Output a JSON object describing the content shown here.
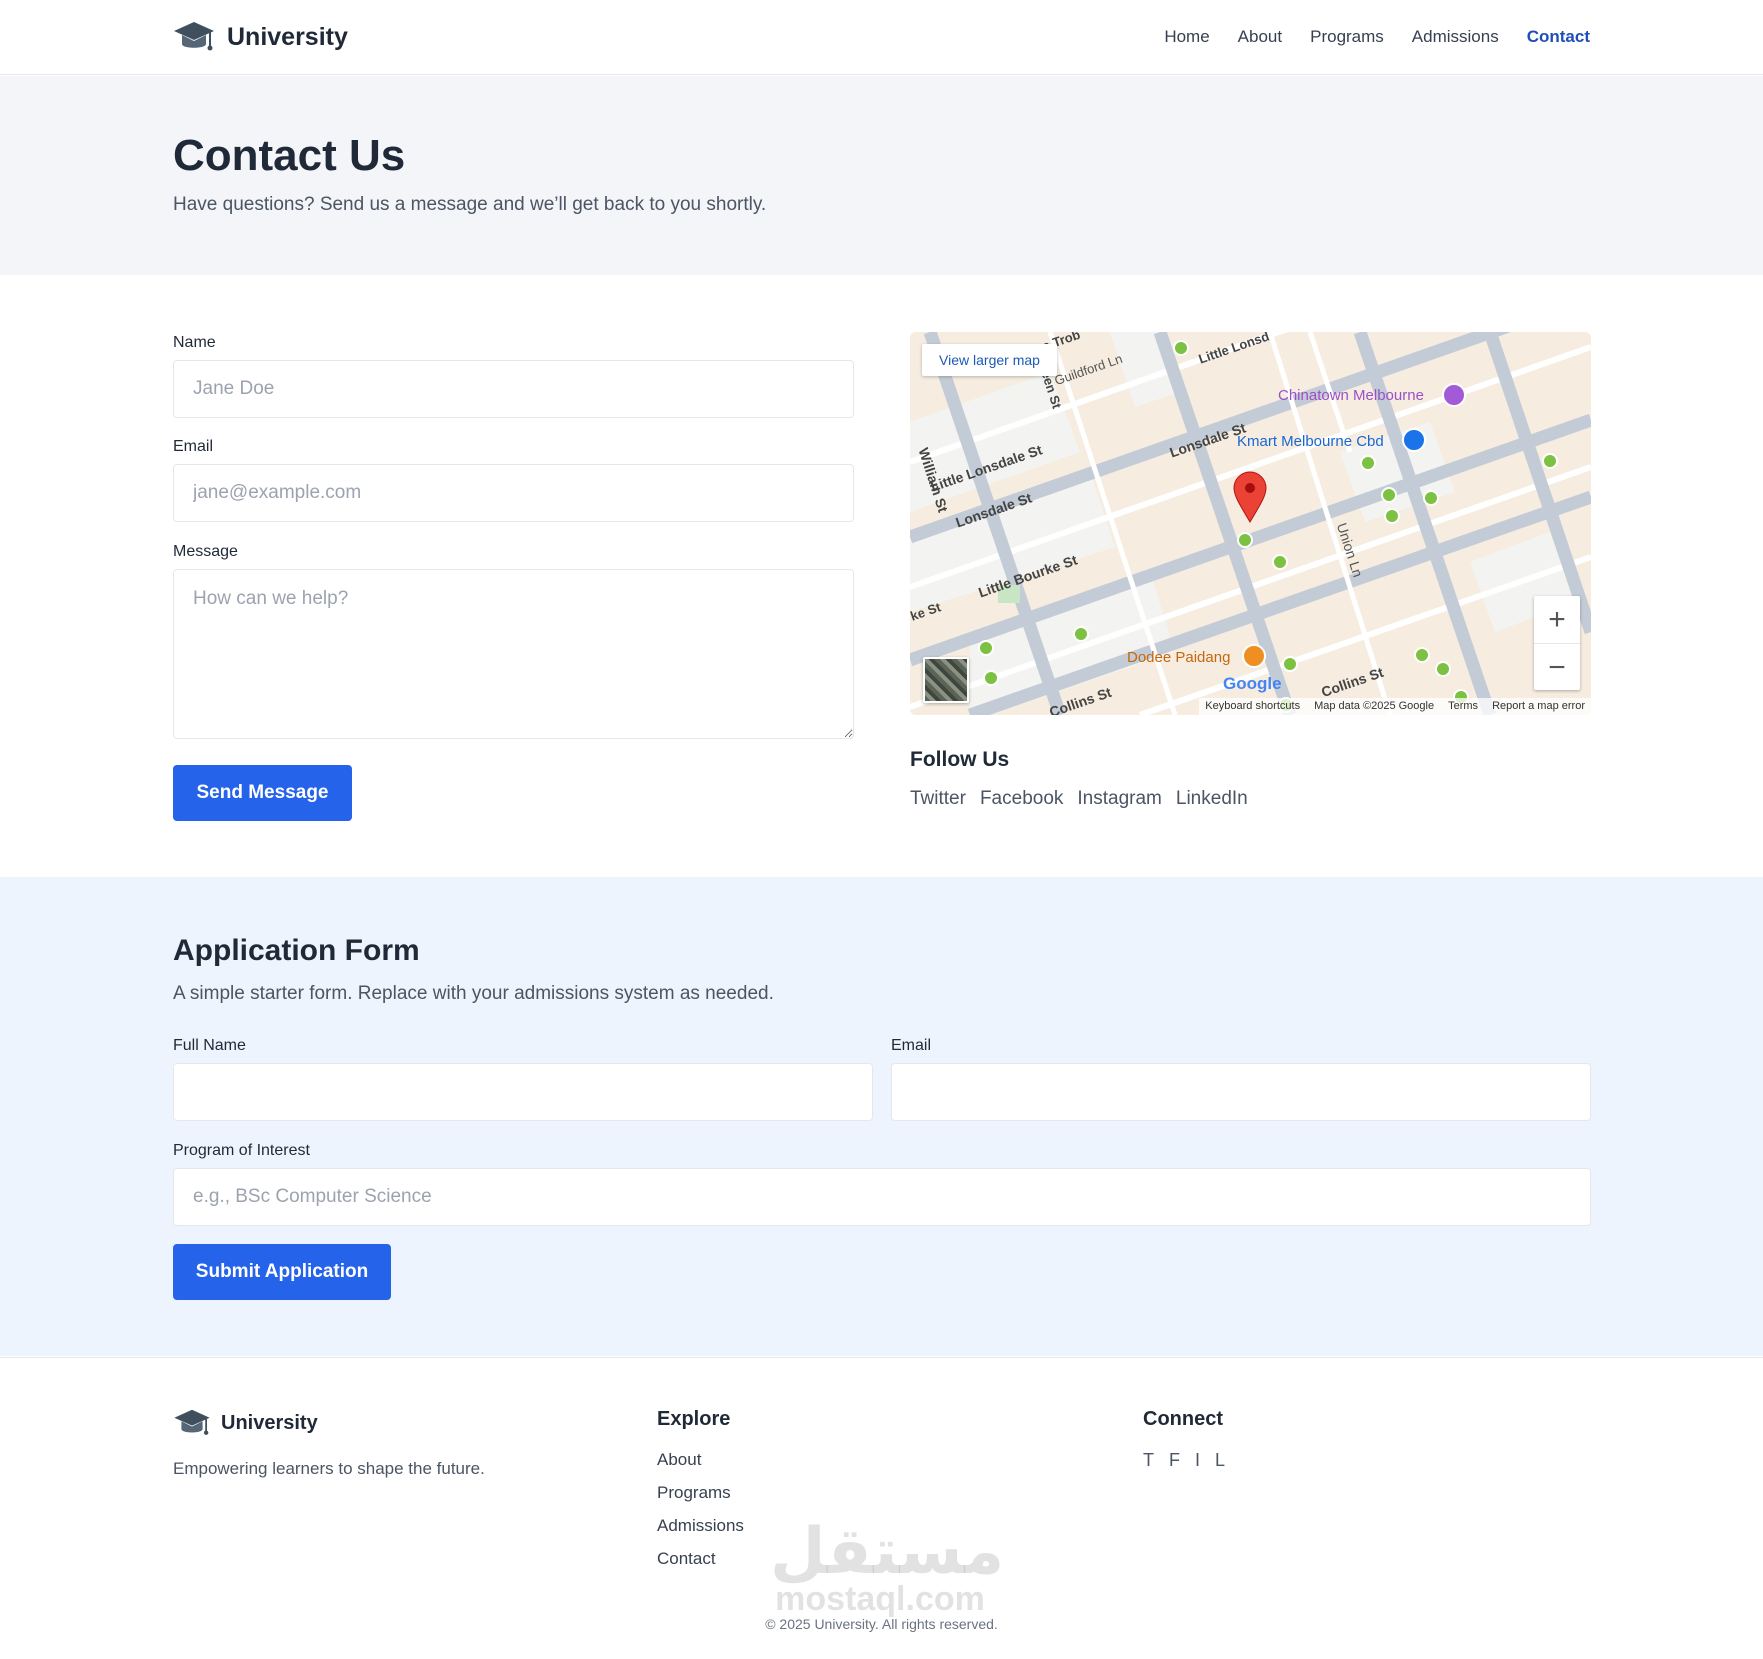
{
  "header": {
    "brand": "University",
    "nav": [
      "Home",
      "About",
      "Programs",
      "Admissions",
      "Contact"
    ],
    "active_nav": "Contact"
  },
  "hero": {
    "title": "Contact Us",
    "subtitle": "Have questions? Send us a message and we’ll get back to you shortly."
  },
  "contact_form": {
    "name_label": "Name",
    "name_placeholder": "Jane Doe",
    "email_label": "Email",
    "email_placeholder": "jane@example.com",
    "message_label": "Message",
    "message_placeholder": "How can we help?",
    "submit_label": "Send Message"
  },
  "map": {
    "view_larger": "View larger map",
    "streets": [
      "Little Lonsdale St",
      "Lonsdale St",
      "Little Bourke St",
      "Collins St",
      "William St",
      "Union Ln",
      "Guildford Ln",
      "Little Lonsd",
      "La Trob",
      "ke St",
      "een St",
      "Lonsdale St",
      "Collins St"
    ],
    "places": [
      "Chinatown Melbourne",
      "Kmart Melbourne Cbd",
      "Dodee Paidang"
    ],
    "zoom_in": "+",
    "zoom_out": "−",
    "google": "Google",
    "attribution": [
      "Keyboard shortcuts",
      "Map data ©2025 Google",
      "Terms",
      "Report a map error"
    ],
    "colors": {
      "road": "#ffffff",
      "major_road": "#c3ccd6",
      "land": "#f6ede0",
      "block": "#f3f3f1",
      "pin": "#ea4335",
      "transit": "#7cc142"
    }
  },
  "follow": {
    "title": "Follow Us",
    "links": [
      "Twitter",
      "Facebook",
      "Instagram",
      "LinkedIn"
    ]
  },
  "application": {
    "title": "Application Form",
    "subtitle": "A simple starter form. Replace with your admissions system as needed.",
    "full_name_label": "Full Name",
    "email_label": "Email",
    "program_label": "Program of Interest",
    "program_placeholder": "e.g., BSc Computer Science",
    "submit_label": "Submit Application"
  },
  "footer": {
    "brand": "University",
    "tagline": "Empowering learners to shape the future.",
    "explore_title": "Explore",
    "explore_links": [
      "About",
      "Programs",
      "Admissions",
      "Contact"
    ],
    "connect_title": "Connect",
    "connect_links": [
      "T",
      "F",
      "I",
      "L"
    ],
    "copyright": "© 2025 University. All rights reserved."
  },
  "watermark": {
    "arabic": "مستقل",
    "latin": "mostaql.com"
  },
  "colors": {
    "primary": "#2563eb",
    "active_nav": "#1e4fb8",
    "hero_bg": "#f3f5f8",
    "app_bg": "#eef4fd"
  },
  "icons": {
    "logo": "graduation-cap-icon"
  }
}
